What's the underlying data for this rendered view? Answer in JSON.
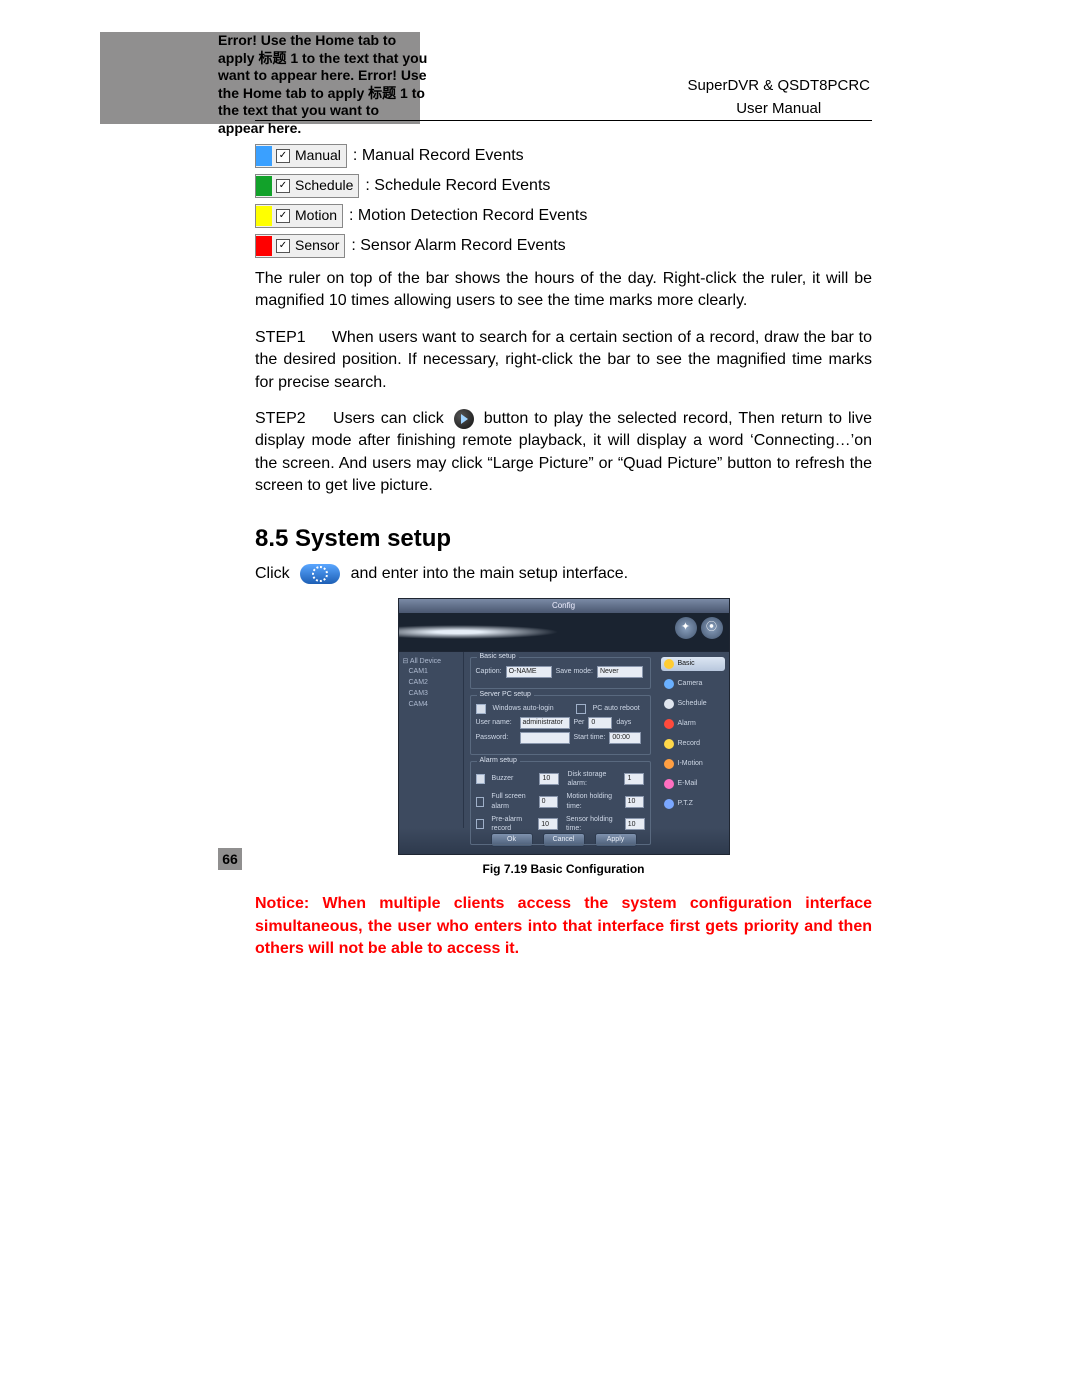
{
  "header": {
    "error_text": "Error! Use the Home tab to apply 标题 1 to the text that you want to appear here. Error! Use the Home tab to apply 标题 1 to the text that you want to appear here.",
    "right_line1": "SuperDVR & QSDT8PCRC",
    "right_line2": "User  Manual"
  },
  "legend": {
    "manual": {
      "chip": "Manual",
      "text": ": Manual Record Events"
    },
    "schedule": {
      "chip": "Schedule",
      "text": ": Schedule Record Events"
    },
    "motion": {
      "chip": "Motion",
      "text": ": Motion Detection Record Events"
    },
    "sensor": {
      "chip": "Sensor",
      "text": ": Sensor Alarm Record Events"
    }
  },
  "ruler_para": "The ruler on top of the bar shows the hours of the day. Right-click the ruler, it will be magnified 10 times allowing users to see the time marks more clearly.",
  "step1": {
    "label": "STEP1",
    "text": "When users want to search for a certain section of a record, draw the bar to the desired position. If necessary, right-click the bar to see the magnified time marks for precise search."
  },
  "step2": {
    "label": "STEP2",
    "before": "Users can click",
    "after": "button to play the selected record, Then return to live display mode after finishing remote playback, it will display a word ‘Connecting…’on the screen. And users may click “Large Picture” or “Quad Picture” button to refresh the screen to get live picture."
  },
  "section": {
    "title": "8.5 System setup",
    "click_before": "Click",
    "click_after": "and enter into the main setup interface."
  },
  "config": {
    "title": "Config",
    "tree_root": "All Device",
    "cams": [
      "CAM1",
      "CAM2",
      "CAM3",
      "CAM4"
    ],
    "basic_setup": {
      "title": "Basic setup",
      "caption_lbl": "Caption:",
      "caption_val": "O-NAME",
      "save_lbl": "Save mode:",
      "save_val": "Never"
    },
    "server_pc": {
      "title": "Server PC setup",
      "win_login": "Windows auto-login",
      "pc_reboot": "PC auto reboot",
      "user_lbl": "User name:",
      "user_val": "administrator",
      "per_lbl": "Per",
      "per_val": "0",
      "days": "days",
      "pwd_lbl": "Password:",
      "start_lbl": "Start time:",
      "start_val": "00:00"
    },
    "alarm": {
      "title": "Alarm setup",
      "buzzer": "Buzzer",
      "buzzer_val": "10",
      "disk_lbl": "Disk storage alarm:",
      "disk_val": "1",
      "full_lbl": "Full screen alarm",
      "full_val": "0",
      "motion_lbl": "Motion holding time:",
      "motion_val": "10",
      "pre_lbl": "Pre-alarm record",
      "pre_val": "10",
      "sensor_lbl": "Sensor holding time:",
      "sensor_val": "10"
    },
    "nav": [
      "Basic",
      "Camera",
      "Schedule",
      "Alarm",
      "Record",
      "I-Motion",
      "E-Mail",
      "P.T.Z"
    ],
    "buttons": {
      "ok": "Ok",
      "cancel": "Cancel",
      "apply": "Apply"
    }
  },
  "caption": "Fig 7.19 Basic Configuration",
  "notice": "Notice: When multiple clients access the system configuration interface simultaneous, the user who enters into that interface first gets priority and then others will not be able to access it.",
  "page_number": "66"
}
